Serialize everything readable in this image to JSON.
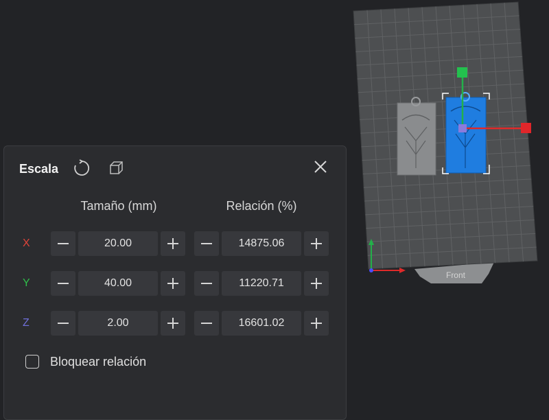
{
  "panel": {
    "title": "Escala",
    "icons": {
      "reset": "reset-rotate-icon",
      "uniform": "cube-outline-icon",
      "close": "close-icon"
    },
    "size_header": "Tamaño (mm)",
    "ratio_header": "Relación (%)",
    "rows": [
      {
        "axis": "X",
        "color": "#e0443a",
        "size": "20.00",
        "ratio": "14875.06"
      },
      {
        "axis": "Y",
        "color": "#2fbf4a",
        "size": "40.00",
        "ratio": "11220.71"
      },
      {
        "axis": "Z",
        "color": "#6f6fd8",
        "size": "2.00",
        "ratio": "16601.02"
      }
    ],
    "lock": {
      "label": "Bloquear relación",
      "checked": false
    }
  },
  "viewport": {
    "bed_label": "Front",
    "colors": {
      "bed": "#4d4f51",
      "grid": "#5f6163",
      "selected": "#1f7de0",
      "unselected": "#8a8c8e",
      "x_axis": "#e02a2a",
      "y_axis": "#23b04a",
      "z_axis": "#4d4dff"
    }
  }
}
